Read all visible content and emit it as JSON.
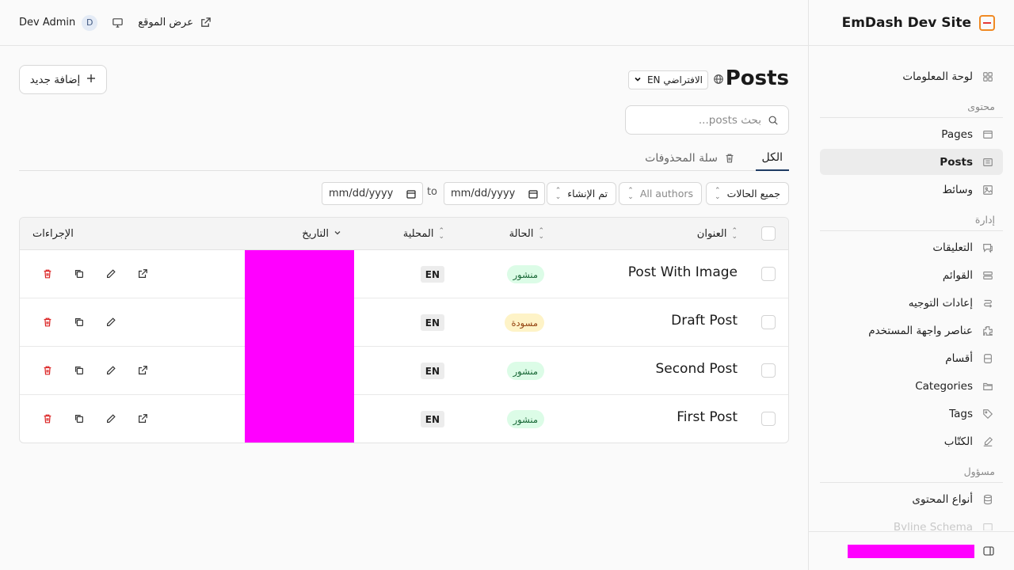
{
  "site": {
    "name": "EmDash Dev Site"
  },
  "header": {
    "user_name": "Dev Admin",
    "avatar_initial": "D",
    "view_site_label": "عرض الموقع"
  },
  "sidebar": {
    "items_top": [
      {
        "label": "لوحة المعلومات",
        "icon": "dashboard-icon"
      }
    ],
    "section_content": "محتوى",
    "items_content": [
      {
        "label": "Pages",
        "icon": "page-icon"
      },
      {
        "label": "Posts",
        "icon": "posts-icon",
        "active": true
      },
      {
        "label": "وسائط",
        "icon": "media-icon"
      }
    ],
    "section_admin": "إدارة",
    "items_admin": [
      {
        "label": "التعليقات",
        "icon": "comments-icon"
      },
      {
        "label": "القوائم",
        "icon": "menus-icon"
      },
      {
        "label": "إعادات التوجيه",
        "icon": "redirects-icon"
      },
      {
        "label": "عناصر واجهة المستخدم",
        "icon": "widgets-icon"
      },
      {
        "label": "أقسام",
        "icon": "sections-icon"
      },
      {
        "label": "Categories",
        "icon": "folder-icon"
      },
      {
        "label": "Tags",
        "icon": "tag-icon"
      },
      {
        "label": "الكتّاب",
        "icon": "authors-icon"
      }
    ],
    "section_manager": "مسؤول",
    "items_manager": [
      {
        "label": "أنواع المحتوى",
        "icon": "database-icon"
      },
      {
        "label": "Byline Schema",
        "icon": "schema-icon"
      }
    ]
  },
  "main": {
    "title": "Posts",
    "add_button": "إضافة جديد",
    "locale_select": "EN الافتراضي",
    "search_placeholder": "بحث posts...",
    "tabs": {
      "all": "الكل",
      "trash": "سلة المحذوفات"
    },
    "filters": {
      "status": "جميع الحالات",
      "authors": "All authors",
      "sort": "تم الإنشاء",
      "date_placeholder": "mm/dd/yyyy",
      "to": "to"
    },
    "columns": {
      "title": "العنوان",
      "status": "الحالة",
      "locale": "المحلية",
      "date": "التاريخ",
      "actions": "الإجراءات"
    },
    "rows": [
      {
        "title": "Post With Image",
        "status": "منشور",
        "status_type": "published",
        "locale": "EN",
        "has_view": true
      },
      {
        "title": "Draft Post",
        "status": "مسودة",
        "status_type": "draft",
        "locale": "EN",
        "has_view": false
      },
      {
        "title": "Second Post",
        "status": "منشور",
        "status_type": "published",
        "locale": "EN",
        "has_view": true
      },
      {
        "title": "First Post",
        "status": "منشور",
        "status_type": "published",
        "locale": "EN",
        "has_view": true
      }
    ]
  }
}
